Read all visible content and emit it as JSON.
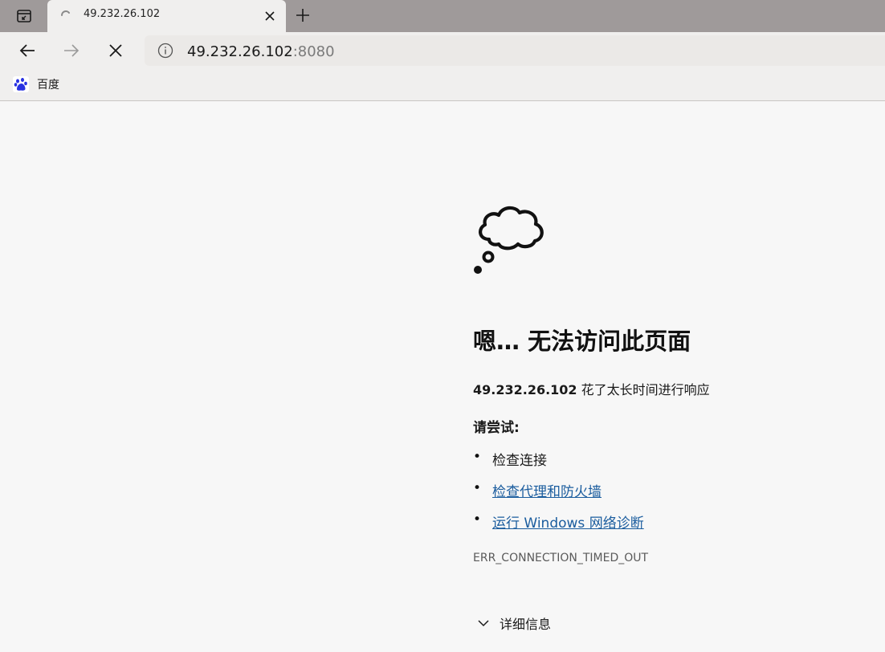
{
  "tab": {
    "title": "49.232.26.102"
  },
  "toolbar": {
    "url_host": "49.232.26.102",
    "url_port": ":8080"
  },
  "bookmarks": {
    "items": [
      {
        "label": "百度",
        "icon": "baidu-paw-icon"
      }
    ]
  },
  "error": {
    "headline": "嗯… 无法访问此页面",
    "host": "49.232.26.102",
    "description": " 花了太长时间进行响应",
    "try_label": "请尝试:",
    "suggestions": [
      {
        "bullet": "•",
        "text": "检查连接",
        "link": false
      },
      {
        "bullet": "•",
        "text": "检查代理和防火墙",
        "link": true
      },
      {
        "bullet": "•",
        "text": "运行 Windows 网络诊断",
        "link": true
      }
    ],
    "code": "ERR_CONNECTION_TIMED_OUT",
    "details_label": "详细信息"
  },
  "colors": {
    "tabstrip": "#9f9a9a",
    "toolbar": "#f0efee",
    "page_bg": "#f7f7f7",
    "link": "#1a5c9e",
    "baidu_blue": "#2932e1"
  }
}
